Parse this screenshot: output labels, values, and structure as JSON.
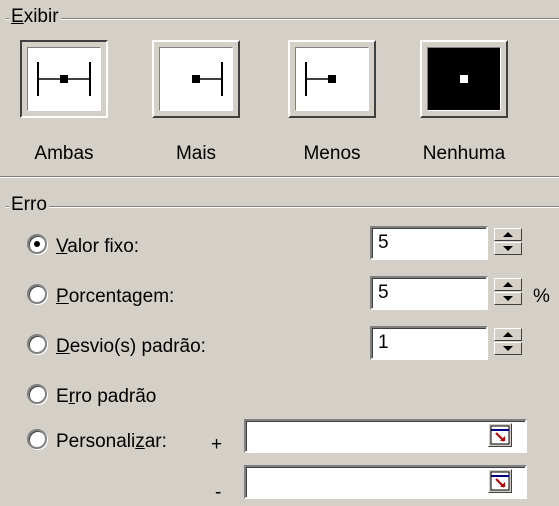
{
  "display_group": {
    "title_accel": "E",
    "title_rest": "xibir",
    "styles": [
      {
        "label": "Ambas",
        "selected": true
      },
      {
        "label": "Mais",
        "selected": false
      },
      {
        "label": "Menos",
        "selected": false
      },
      {
        "label": "Nenhuma",
        "selected": false
      }
    ]
  },
  "error_group": {
    "title": "Erro",
    "options": [
      {
        "pre": "",
        "accel": "V",
        "post": "alor fixo:",
        "selected": true
      },
      {
        "pre": "",
        "accel": "P",
        "post": "orcentagem:",
        "selected": false
      },
      {
        "pre": "",
        "accel": "D",
        "post": "esvio(s) padrão:",
        "selected": false
      },
      {
        "pre": "E",
        "accel": "r",
        "post": "ro padrão",
        "selected": false
      },
      {
        "pre": "Personali",
        "accel": "z",
        "post": "ar:",
        "selected": false
      }
    ],
    "fixed_value": "5",
    "percentage": "5",
    "percent_symbol": "%",
    "std_dev": "1",
    "custom_plus_sign": "+",
    "custom_minus_sign": "-",
    "custom_plus_value": "",
    "custom_minus_value": ""
  }
}
